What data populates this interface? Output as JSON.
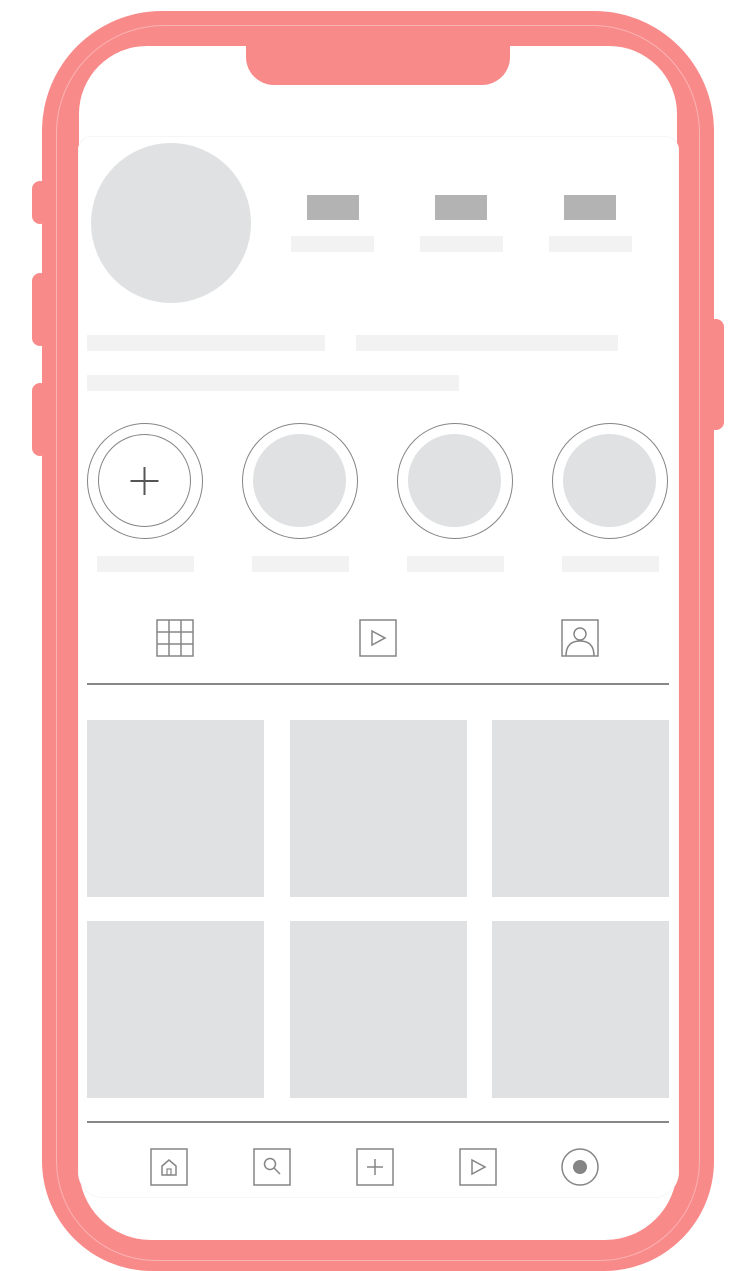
{
  "device": {
    "frame_color": "#f98a8a"
  },
  "profile": {
    "avatar": "avatar-placeholder",
    "stats": [
      "posts-count",
      "followers-count",
      "following-count"
    ],
    "bio_lines": 3
  },
  "highlights": [
    {
      "kind": "new",
      "icon": "plus-icon"
    },
    {
      "kind": "highlight"
    },
    {
      "kind": "highlight"
    },
    {
      "kind": "highlight"
    }
  ],
  "tabs": [
    {
      "icon": "grid-icon",
      "selected": true
    },
    {
      "icon": "reels-icon",
      "selected": false
    },
    {
      "icon": "tagged-icon",
      "selected": false
    }
  ],
  "posts": 6,
  "bottom_nav": [
    "home-icon",
    "search-icon",
    "add-icon",
    "reels-icon",
    "profile-icon"
  ],
  "colors": {
    "placeholder": "#dfe1e2",
    "text_placeholder": "#f2f2f2",
    "stat_placeholder": "#b3b3b3",
    "stroke": "#858585"
  }
}
